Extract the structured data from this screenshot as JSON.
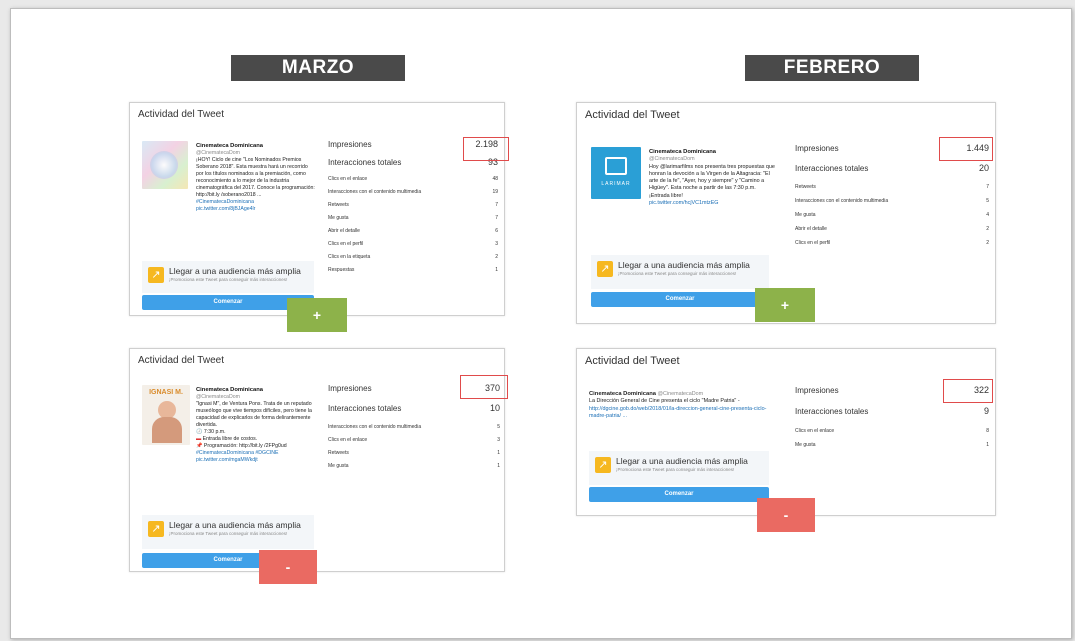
{
  "months": {
    "left": "MARZO",
    "right": "FEBRERO"
  },
  "colors": {
    "label_bg": "#4a4a4a",
    "plus": "#8db24a",
    "minus": "#ea6a62",
    "highlight": "#e04b4b",
    "button": "#3fa0e8"
  },
  "cards": {
    "marzo_top": {
      "title": "Actividad del Tweet",
      "tweet": {
        "name": "Cinemateca Dominicana",
        "handle": "@CinematecaDom",
        "body": "¡HOY! Ciclo de cine \"Los Nominados Premios Soberano 2018\". Esta muestra hará un recorrido por los títulos nominados a la premiación, como reconocimiento a lo mejor de la industria cinematográfica del 2017. Conoce la programación: http://bit.ly /soberano2018 ...",
        "hashtag": "#CinematecaDominicana",
        "link": "pic.twitter.com/8jBJAge4lr"
      },
      "stats_main": [
        {
          "label": "Impresiones",
          "value": "2.198"
        },
        {
          "label": "Interacciones totales",
          "value": "93"
        }
      ],
      "stats": [
        {
          "label": "Clics en el enlace",
          "value": "48"
        },
        {
          "label": "Interacciones con el contenido multimedia",
          "value": "19"
        },
        {
          "label": "Retweets",
          "value": "7"
        },
        {
          "label": "Me gusta",
          "value": "7"
        },
        {
          "label": "Abrir el detalle",
          "value": "6"
        },
        {
          "label": "Clics en el perfil",
          "value": "3"
        },
        {
          "label": "Clics en la etiqueta",
          "value": "2"
        },
        {
          "label": "Respuestas",
          "value": "1"
        }
      ],
      "promo_title": "Llegar a una audiencia más amplia",
      "promo_sub": "¡Promociona este Tweet para conseguir más interacciones!",
      "button": "Comenzar",
      "badge": "+"
    },
    "febrero_top": {
      "title": "Actividad del Tweet",
      "tweet": {
        "name": "Cinemateca Dominicana",
        "handle": "@CinematecaDom",
        "body": "Hoy @larimarfilms nos presenta tres propuestas que honran la devoción a la Virgen de la Altagracia: \"El arte de la fe\", \"Ayer, hoy y siempre\" y \"Camino a Higüey\". Esta noche a partir de las 7:30 p.m. ¡Entrada libre!",
        "link": "pic.twitter.com/hcjVC1mtzEG"
      },
      "logo_text": "LARIMAR",
      "stats_main": [
        {
          "label": "Impresiones",
          "value": "1.449"
        },
        {
          "label": "Interacciones totales",
          "value": "20"
        }
      ],
      "stats": [
        {
          "label": "Retweets",
          "value": "7"
        },
        {
          "label": "Interacciones con el contenido multimedia",
          "value": "5"
        },
        {
          "label": "Me gusta",
          "value": "4"
        },
        {
          "label": "Abrir el detalle",
          "value": "2"
        },
        {
          "label": "Clics en el perfil",
          "value": "2"
        }
      ],
      "promo_title": "Llegar a una audiencia más amplia",
      "promo_sub": "¡Promociona este Tweet para conseguir más interacciones!",
      "button": "Comenzar",
      "badge": "+"
    },
    "marzo_bottom": {
      "title": "Actividad del Tweet",
      "tweet": {
        "name": "Cinemateca Dominicana",
        "handle": "@CinematecaDom",
        "body": "\"Ignasi M\", de Ventura Pons. Trata de un reputado museólogo que vive tiempos difíciles, pero tiene la capacidad de explicarlos de forma delirantemente divertida.",
        "time": "7:30 p.m.",
        "entry": "Entrada libre de costos.",
        "program": "Programación: http://bit.ly /2FPg0ud",
        "hashtag": "#CinematecaDominicana #DGCINE",
        "link": "pic.twitter.com/mgaMWkdjt"
      },
      "poster_text": "IGNASI M.",
      "stats_main": [
        {
          "label": "Impresiones",
          "value": "370"
        },
        {
          "label": "Interacciones totales",
          "value": "10"
        }
      ],
      "stats": [
        {
          "label": "Interacciones con el contenido multimedia",
          "value": "5"
        },
        {
          "label": "Clics en el enlace",
          "value": "3"
        },
        {
          "label": "Retweets",
          "value": "1"
        },
        {
          "label": "Me gusta",
          "value": "1"
        }
      ],
      "promo_title": "Llegar a una audiencia más amplia",
      "promo_sub": "¡Promociona este Tweet para conseguir más interacciones!",
      "button": "Comenzar",
      "badge": "-"
    },
    "febrero_bottom": {
      "title": "Actividad del Tweet",
      "tweet": {
        "name": "Cinemateca Dominicana",
        "handle": "@CinematecaDom",
        "body": "La Dirección General de Cine presenta el ciclo \"Madre Patria\" -",
        "link": "http://dgcine.gob.do/web/2018/01/la-direccion-general-cine-presenta-ciclo-madre-patria/ ..."
      },
      "stats_main": [
        {
          "label": "Impresiones",
          "value": "322"
        },
        {
          "label": "Interacciones totales",
          "value": "9"
        }
      ],
      "stats": [
        {
          "label": "Clics en el enlace",
          "value": "8"
        },
        {
          "label": "Me gusta",
          "value": "1"
        }
      ],
      "promo_title": "Llegar a una audiencia más amplia",
      "promo_sub": "¡Promociona este Tweet para conseguir más interacciones!",
      "button": "Comenzar",
      "badge": "-"
    }
  }
}
